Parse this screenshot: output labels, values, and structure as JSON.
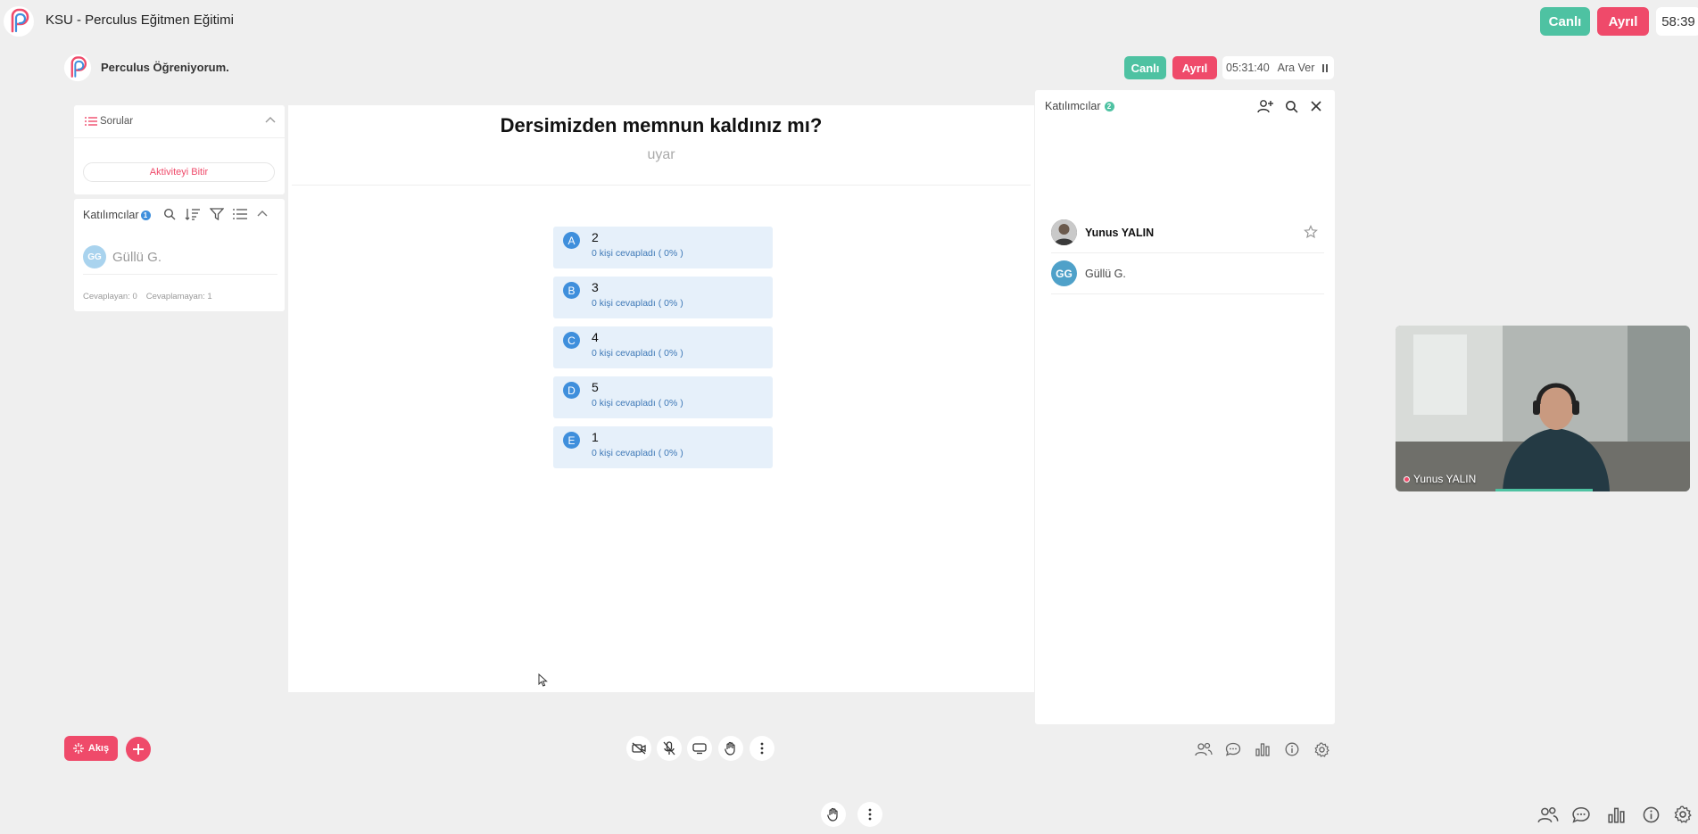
{
  "top_bar": {
    "title": "KSU - Perculus Eğitmen Eğitimi",
    "live_label": "Canlı",
    "separate_label": "Ayrıl",
    "timer": "58:39"
  },
  "session": {
    "title": "Perculus Öğreniyorum.",
    "live_label": "Canlı",
    "separate_label": "Ayrıl",
    "elapsed": "05:31:40",
    "break_label": "Ara Ver"
  },
  "questions_panel": {
    "title": "Sorular",
    "end_activity": "Aktiviteyi Bitir"
  },
  "participants_panel": {
    "title": "Katılımcılar",
    "count": "1",
    "participants": [
      {
        "initials": "GG",
        "name": "Güllü G."
      }
    ],
    "answered": "Cevaplayan: 0",
    "not_answered": "Cevaplamayan: 1"
  },
  "poll": {
    "question": "Dersimizden memnun kaldınız mı?",
    "subtitle": "uyar",
    "options": [
      {
        "letter": "A",
        "value": "2",
        "count": "0 kişi cevapladı ( 0% )"
      },
      {
        "letter": "B",
        "value": "3",
        "count": "0 kişi cevapladı ( 0% )"
      },
      {
        "letter": "C",
        "value": "4",
        "count": "0 kişi cevapladı ( 0% )"
      },
      {
        "letter": "D",
        "value": "5",
        "count": "0 kişi cevapladı ( 0% )"
      },
      {
        "letter": "E",
        "value": "1",
        "count": "0 kişi cevapladı ( 0% )"
      }
    ]
  },
  "right_panel": {
    "title": "Katılımcılar",
    "count": "2",
    "participants": [
      {
        "name": "Yunus YALIN",
        "initials": ""
      },
      {
        "name": "Güllü G.",
        "initials": "GG"
      }
    ]
  },
  "video": {
    "name": "Yunus YALIN",
    "audio_level": 0.5
  },
  "bottom_bar": {
    "flow_label": "Akış"
  },
  "colors": {
    "accent_green": "#4ec2a2",
    "accent_red": "#ef4a6a",
    "accent_blue": "#3f8fdc"
  }
}
